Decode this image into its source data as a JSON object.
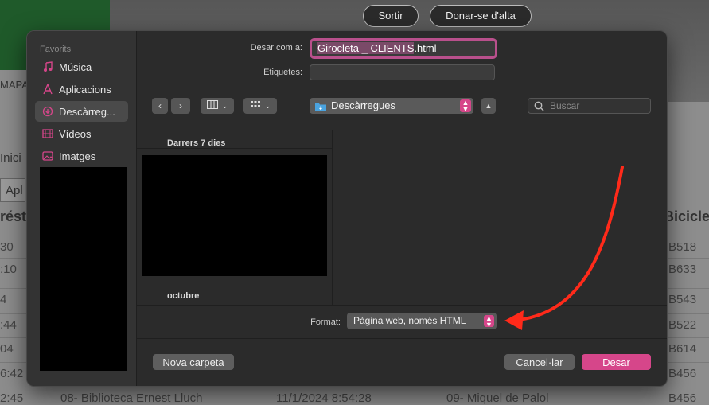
{
  "background": {
    "header_buttons": [
      "Sortir",
      "Donar-se d'alta"
    ],
    "left_labels": [
      "MAPA",
      "Inici",
      "Apl"
    ],
    "column_heads": [
      "réstec",
      "Bicicle"
    ],
    "rows": [
      {
        "left": "30",
        "right": "B518"
      },
      {
        "left": ":10",
        "right": "B633"
      },
      {
        "left": "4",
        "right": "B543"
      },
      {
        "left": ":44",
        "right": "B522"
      },
      {
        "left": "04",
        "right": "B614"
      },
      {
        "left": "6:42",
        "right": "B456"
      },
      {
        "left": "2:45",
        "right": "B456",
        "c2": "08- Biblioteca Ernest Lluch",
        "c3": "11/1/2024 8:54:28",
        "c4": "09- Miquel de Palol"
      }
    ]
  },
  "dialog": {
    "sidebar": {
      "section": "Favorits",
      "items": [
        {
          "label": "Música",
          "icon": "music-note-icon"
        },
        {
          "label": "Aplicacions",
          "icon": "applications-icon"
        },
        {
          "label": "Descàrreg...",
          "icon": "download-icon"
        },
        {
          "label": "Vídeos",
          "icon": "film-icon"
        },
        {
          "label": "Imatges",
          "icon": "photo-icon"
        }
      ]
    },
    "save_as_label": "Desar com a:",
    "filename_selected": "Girocleta _ CLIENTS",
    "filename_ext": ".html",
    "tags_label": "Etiquetes:",
    "location": "Descàrregues",
    "search_placeholder": "Buscar",
    "sections": [
      "Darrers 7 dies",
      "octubre"
    ],
    "format_label": "Format:",
    "format_value": "Pàgina web, només HTML",
    "new_folder": "Nova carpeta",
    "cancel": "Cancel·lar",
    "save": "Desar"
  },
  "colors": {
    "accent": "#d6468a",
    "annotation_arrow": "#ff2a1a"
  }
}
